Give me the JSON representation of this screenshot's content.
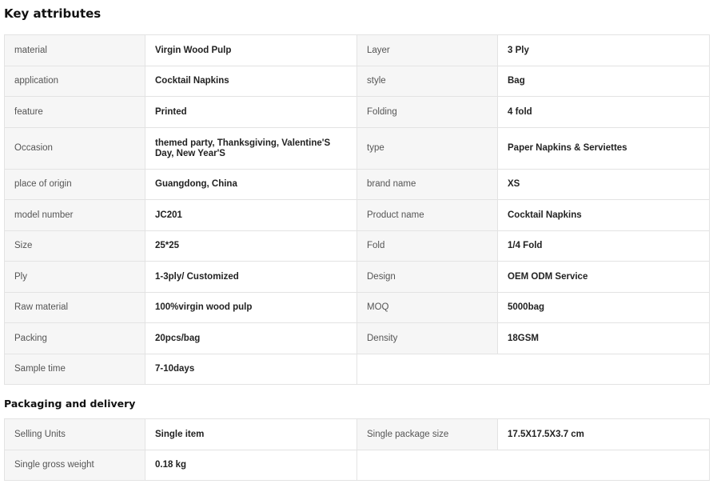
{
  "key_attributes": {
    "title": "Key attributes",
    "rows": [
      {
        "l1": "material",
        "v1": "Virgin Wood Pulp",
        "l2": "Layer",
        "v2": "3 Ply"
      },
      {
        "l1": "application",
        "v1": "Cocktail Napkins",
        "l2": "style",
        "v2": "Bag"
      },
      {
        "l1": "feature",
        "v1": "Printed",
        "l2": "Folding",
        "v2": "4 fold"
      },
      {
        "l1": "Occasion",
        "v1": "themed party, Thanksgiving, Valentine'S Day, New Year'S",
        "l2": "type",
        "v2": "Paper Napkins & Serviettes"
      },
      {
        "l1": "place of origin",
        "v1": "Guangdong, China",
        "l2": "brand name",
        "v2": "XS"
      },
      {
        "l1": "model number",
        "v1": "JC201",
        "l2": "Product name",
        "v2": "Cocktail Napkins"
      },
      {
        "l1": "Size",
        "v1": "25*25",
        "l2": "Fold",
        "v2": "1/4 Fold"
      },
      {
        "l1": "Ply",
        "v1": "1-3ply/ Customized",
        "l2": "Design",
        "v2": "OEM ODM Service"
      },
      {
        "l1": "Raw material",
        "v1": "100%virgin wood pulp",
        "l2": "MOQ",
        "v2": "5000bag"
      },
      {
        "l1": "Packing",
        "v1": "20pcs/bag",
        "l2": "Density",
        "v2": "18GSM"
      },
      {
        "l1": "Sample time",
        "v1": "7-10days"
      }
    ]
  },
  "packaging": {
    "title": "Packaging and delivery",
    "rows": [
      {
        "l1": "Selling Units",
        "v1": "Single item",
        "l2": "Single package size",
        "v2": "17.5X17.5X3.7 cm"
      },
      {
        "l1": "Single gross weight",
        "v1": "0.18 kg"
      }
    ]
  }
}
